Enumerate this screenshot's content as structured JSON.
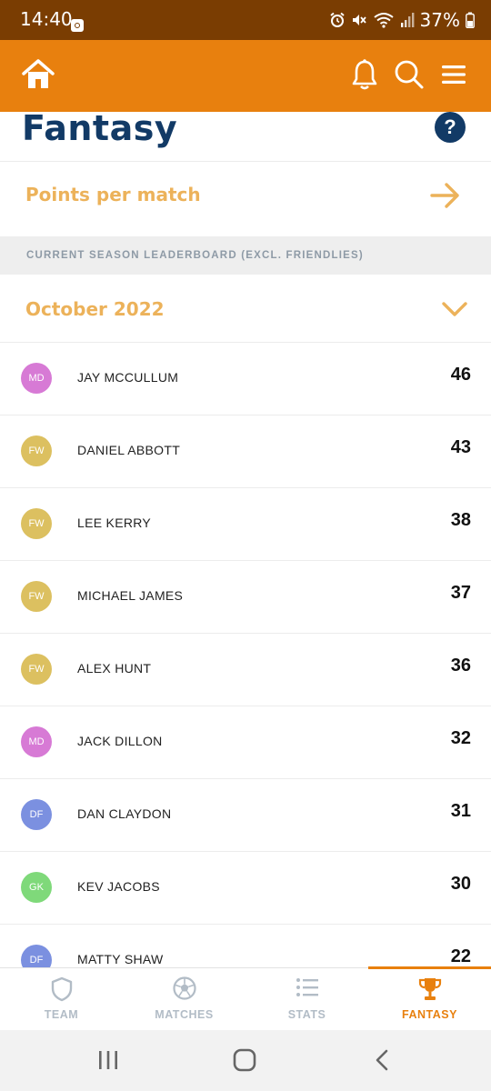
{
  "status_bar": {
    "time": "14:40",
    "battery": "37%",
    "icons": [
      "app-notification-icon",
      "alarm-icon",
      "mute-icon",
      "wifi-icon",
      "signal-icon",
      "battery-icon"
    ]
  },
  "header": {
    "icons": [
      "home-icon",
      "bell-icon",
      "search-icon",
      "menu-icon"
    ],
    "background": "#e8800e"
  },
  "page": {
    "title": "Fantasy",
    "help_label": "?"
  },
  "points_per_match": {
    "label": "Points per match"
  },
  "leaderboard": {
    "section_label": "CURRENT SEASON LEADERBOARD (EXCL. FRIENDLIES)",
    "month": "October 2022",
    "position_colors": {
      "MD": "#d77ad5",
      "FW": "#dcc060",
      "DF": "#7b90e0",
      "GK": "#7fd97a"
    },
    "rows": [
      {
        "position": "MD",
        "name": "JAY MCCULLUM",
        "points": "46"
      },
      {
        "position": "FW",
        "name": "DANIEL ABBOTT",
        "points": "43"
      },
      {
        "position": "FW",
        "name": "LEE KERRY",
        "points": "38"
      },
      {
        "position": "FW",
        "name": "MICHAEL JAMES",
        "points": "37"
      },
      {
        "position": "FW",
        "name": "ALEX HUNT",
        "points": "36"
      },
      {
        "position": "MD",
        "name": "JACK DILLON",
        "points": "32"
      },
      {
        "position": "DF",
        "name": "DAN CLAYDON",
        "points": "31"
      },
      {
        "position": "GK",
        "name": "KEV JACOBS",
        "points": "30"
      },
      {
        "position": "DF",
        "name": "MATTY SHAW",
        "points": "22"
      }
    ]
  },
  "bottom_nav": {
    "items": [
      {
        "label": "TEAM",
        "icon": "shield-icon"
      },
      {
        "label": "MATCHES",
        "icon": "football-icon"
      },
      {
        "label": "STATS",
        "icon": "list-icon"
      },
      {
        "label": "FANTASY",
        "icon": "trophy-icon",
        "active": true
      }
    ]
  },
  "system_nav": {
    "icons": [
      "recent-apps-icon",
      "home-button-icon",
      "back-icon"
    ]
  }
}
